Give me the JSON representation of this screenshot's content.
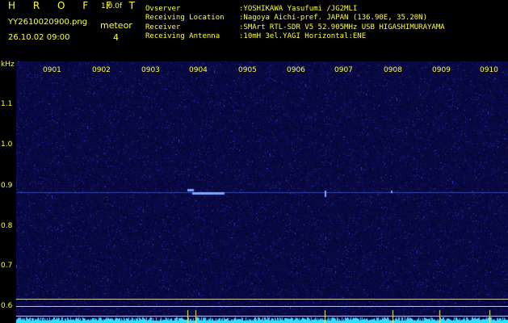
{
  "header": {
    "logo": "H R O F F T",
    "version": "1.0.0f",
    "filename": "YY2610020900.png",
    "datetime": "26.10.02 09:00",
    "meteor_label": "meteor",
    "meteor_count": "4",
    "info_labels": [
      "Ovserver",
      "Receiving Location",
      "Receiver",
      "Receiving Antenna"
    ],
    "info_values": [
      ":YOSHIKAWA Yasufumi /JG2MLI",
      ":Nagoya Aichi-pref. JAPAN (136.90E, 35.20N)",
      ":SMArt RTL-SDR V5 52.905MHz USB HIGASHIMURAYAMA",
      ":10mH 3el.YAGI Horizontal:ENE"
    ]
  },
  "axis": {
    "unit": "kHz",
    "y_ticks": [
      "1.1",
      "1.0",
      "0.9",
      "0.8",
      "0.7",
      "0.6"
    ],
    "x_ticks": [
      "0901",
      "0902",
      "0903",
      "0904",
      "0905",
      "0906",
      "0907",
      "0908",
      "0909",
      "0910"
    ]
  },
  "colors": {
    "text": "#ffff33",
    "background": "#000000",
    "noise": "#0a0a50",
    "signal": "#33ddff"
  }
}
